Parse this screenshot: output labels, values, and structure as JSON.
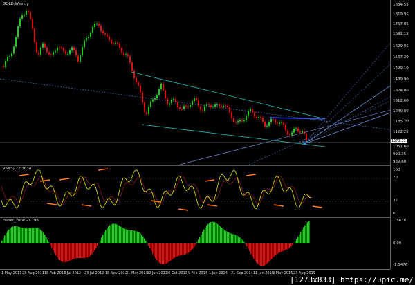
{
  "main": {
    "title": "GOLD,Weekly",
    "price_labels": [
      "1884.55",
      "1819.95",
      "1757.05",
      "1692.15",
      "1629.95",
      "1567.20",
      "1499.10",
      "1439.90",
      "1374.80",
      "1312.60",
      "1249.80",
      "1185.20",
      "1122.25",
      "1057.60",
      "990.35",
      "932.60"
    ],
    "current_price": "1073.33"
  },
  "rsi": {
    "title": "RSI(5) 22.3634",
    "levels": [
      "100",
      "70",
      "32",
      "0"
    ]
  },
  "fisher": {
    "title": "Fisher_Yurik -0.298",
    "levels": [
      "1.5616",
      "0.00",
      "-1.5476"
    ]
  },
  "x_axis_labels": [
    "1 May 2011",
    "28 Aug 2011",
    "18 Feb 2012",
    "8 Jul 2012",
    "23 Jul 2012",
    "18 Nov 2012",
    "31 Mar 2013",
    "30 Jun 2013",
    "20 Oct 2013",
    "9 Feb 2014",
    "1 Jun 2014",
    "21 Sep 2014",
    "11 Jan 2015",
    "3 May 2015",
    "23 Aug 2015"
  ],
  "watermark": "[1273x833] https://upic.me/",
  "colors": {
    "bull": "#1fcc1f",
    "bear": "#e01010",
    "rsi": "#e8e800",
    "arrow": "#ff7a1a",
    "channel": "#29bfbf",
    "dotted": "#4a78c8"
  }
}
